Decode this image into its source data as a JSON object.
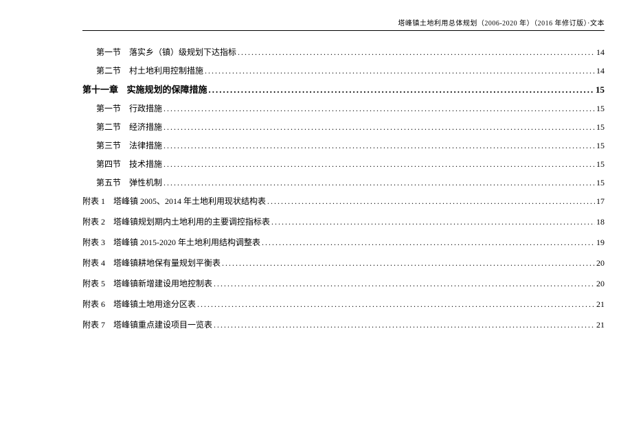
{
  "header_text": "塔峰镇土地利用总体规划（2006-2020 年）（2016 年修订版）·文本",
  "toc": [
    {
      "kind": "section",
      "label": "第一节",
      "title": "落实乡（镇）级规划下达指标",
      "page": "14"
    },
    {
      "kind": "section",
      "label": "第二节",
      "title": "村土地利用控制措施",
      "page": "14"
    },
    {
      "kind": "chapter",
      "label": "第十一章",
      "title": "实施规划的保障措施",
      "page": "15"
    },
    {
      "kind": "section",
      "label": "第一节",
      "title": "行政措施",
      "page": "15"
    },
    {
      "kind": "section",
      "label": "第二节",
      "title": "经济措施",
      "page": "15"
    },
    {
      "kind": "section",
      "label": "第三节",
      "title": "法律措施",
      "page": "15"
    },
    {
      "kind": "section",
      "label": "第四节",
      "title": "技术措施",
      "page": "15"
    },
    {
      "kind": "section",
      "label": "第五节",
      "title": "弹性机制",
      "page": "15"
    },
    {
      "kind": "appendix",
      "label": "附表 1",
      "title": "塔峰镇 2005、2014 年土地利用现状结构表",
      "page": "17"
    },
    {
      "kind": "appendix",
      "label": "附表 2",
      "title": "塔峰镇规划期内土地利用的主要调控指标表",
      "page": "18"
    },
    {
      "kind": "appendix",
      "label": "附表 3",
      "title": "塔峰镇 2015-2020 年土地利用结构调整表",
      "page": "19"
    },
    {
      "kind": "appendix",
      "label": "附表 4",
      "title": "塔峰镇耕地保有量规划平衡表",
      "page": "20"
    },
    {
      "kind": "appendix",
      "label": "附表 5",
      "title": "塔峰镇新增建设用地控制表",
      "page": "20"
    },
    {
      "kind": "appendix",
      "label": "附表 6",
      "title": "塔峰镇土地用途分区表",
      "page": "21"
    },
    {
      "kind": "appendix",
      "label": "附表 7",
      "title": "塔峰镇重点建设项目一览表",
      "page": "21"
    }
  ]
}
